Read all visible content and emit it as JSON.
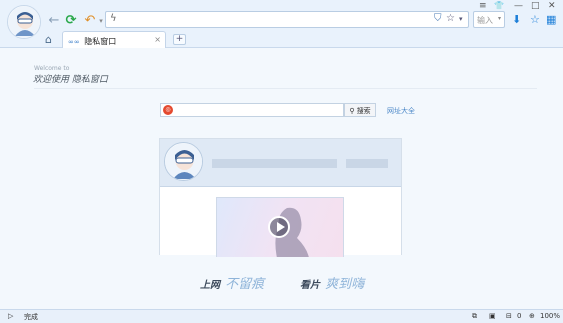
{
  "toolbar": {
    "address_value": "",
    "search_placeholder": "输入",
    "win_menu": "≡",
    "win_skin": "👕",
    "win_min": "—",
    "win_max": "□",
    "win_close": "✕"
  },
  "tabs": [
    {
      "label": "隐私窗口",
      "badge": "∞∞"
    }
  ],
  "content": {
    "welcome_en": "Welcome to",
    "welcome_cn": "欢迎使用 隐私窗口",
    "search_button": "搜索",
    "search_value": "",
    "nav_link": "网址大全",
    "slogan_left_a": "上网",
    "slogan_left_b": "不留痕",
    "slogan_right_a": "看片",
    "slogan_right_b": "爽到嗨"
  },
  "status": {
    "text": "完成",
    "download_count": "0",
    "zoom": "100%"
  },
  "colors": {
    "accent": "#1d7fd8",
    "chrome_bg": "#e9f2fc",
    "page_bg": "#f3f8fd"
  }
}
